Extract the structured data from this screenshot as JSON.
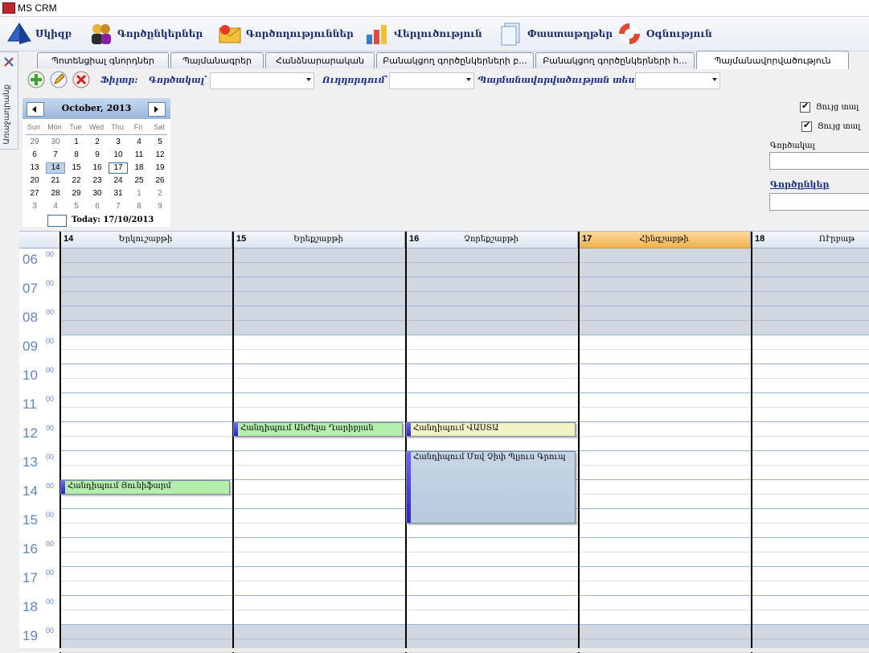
{
  "window": {
    "title": "MS CRM"
  },
  "menu": [
    {
      "label": "Սկիզբ",
      "icon": "pyramid-icon"
    },
    {
      "label": "Գործընկերներ",
      "icon": "people-icon"
    },
    {
      "label": "Գործողություններ",
      "icon": "envelope-icon"
    },
    {
      "label": "Վերլուծություն",
      "icon": "chart-icon"
    },
    {
      "label": "Փաստաթղթեր",
      "icon": "documents-icon"
    },
    {
      "label": "Օգնություն",
      "icon": "lifebuoy-icon"
    }
  ],
  "side_tab": {
    "label": "Առաջադրանք"
  },
  "tabs": [
    {
      "label": "Պոտենցիալ գնորդներ"
    },
    {
      "label": "Պայմանագրեր"
    },
    {
      "label": "Հանձնարարական"
    },
    {
      "label": "Բանակցող գործընկերների բ..."
    },
    {
      "label": "Բանակցող գործընկերների h..."
    },
    {
      "label": "Պայմանավորվածություն",
      "active": true
    }
  ],
  "toolbar": {
    "filter_label": "Ֆիլտր:",
    "employee_label": "Գործակալ՝",
    "direction_label": "Ուղղորդում՝",
    "appointment_type_label": "Պայմանավորվածության տեսակ",
    "employee_value": "",
    "direction_value": "",
    "appointment_type_value": ""
  },
  "calendar": {
    "month_label": "October, 2013",
    "weekdays": [
      "Sun",
      "Mon",
      "Tue",
      "Wed",
      "Thu",
      "Fri",
      "Sat"
    ],
    "weeks": [
      [
        [
          "29",
          1
        ],
        [
          "30",
          1
        ],
        [
          "1",
          0
        ],
        [
          "2",
          0
        ],
        [
          "3",
          0
        ],
        [
          "4",
          0
        ],
        [
          "5",
          0
        ]
      ],
      [
        [
          "6",
          0
        ],
        [
          "7",
          0
        ],
        [
          "8",
          0
        ],
        [
          "9",
          0
        ],
        [
          "10",
          0
        ],
        [
          "11",
          0
        ],
        [
          "12",
          0
        ]
      ],
      [
        [
          "13",
          0
        ],
        [
          "14",
          0
        ],
        [
          "15",
          0
        ],
        [
          "16",
          0
        ],
        [
          "17",
          0
        ],
        [
          "18",
          0
        ],
        [
          "19",
          0
        ]
      ],
      [
        [
          "20",
          0
        ],
        [
          "21",
          0
        ],
        [
          "22",
          0
        ],
        [
          "23",
          0
        ],
        [
          "24",
          0
        ],
        [
          "25",
          0
        ],
        [
          "26",
          0
        ]
      ],
      [
        [
          "27",
          0
        ],
        [
          "28",
          0
        ],
        [
          "29",
          0
        ],
        [
          "30",
          0
        ],
        [
          "31",
          0
        ],
        [
          "1",
          1
        ],
        [
          "2",
          1
        ]
      ],
      [
        [
          "3",
          1
        ],
        [
          "4",
          1
        ],
        [
          "5",
          1
        ],
        [
          "6",
          1
        ],
        [
          "7",
          1
        ],
        [
          "8",
          1
        ],
        [
          "9",
          1
        ]
      ]
    ],
    "selected_day": "14",
    "today_day": "17",
    "today_label": "Today: 17/10/2013"
  },
  "right_panel": {
    "checkbox1_label": "Ցույց տալ",
    "checkbox2_label": "Ցույց տալ",
    "agent_label": "Գործակալ",
    "partners_label": "Գործընկեր"
  },
  "schedule": {
    "days": [
      {
        "num": "14",
        "name": "Երկուշաբթի"
      },
      {
        "num": "15",
        "name": "Երեքշաբթի"
      },
      {
        "num": "16",
        "name": "Չորեքշաբթի"
      },
      {
        "num": "17",
        "name": "Հինգշաբթի",
        "current": true
      },
      {
        "num": "18",
        "name": "ՈՒրբաթ"
      }
    ],
    "hours": [
      "06",
      "07",
      "08",
      "09",
      "10",
      "11",
      "12",
      "13",
      "14",
      "15",
      "16",
      "17",
      "18",
      "19"
    ],
    "minutes_label": "00",
    "appointments": [
      {
        "day": 1,
        "start": 12.0,
        "end": 12.5,
        "text": "Հանդիպում Անժելա Ղարիբյան",
        "color": "#b3eeaa"
      },
      {
        "day": 2,
        "start": 12.0,
        "end": 12.5,
        "text": "Հանդիպում ՎԱՍՏԱ",
        "color": "#f0f3c2"
      },
      {
        "day": 2,
        "start": 13.0,
        "end": 15.5,
        "text": "Հանդիպում Մով Չիփ Պլյուս Գրուպ",
        "color": "#c7d6e6"
      },
      {
        "day": 0,
        "start": 14.0,
        "end": 14.5,
        "text": "Հանդիպում Յունիֆարմ",
        "color": "#b3eeaa"
      }
    ]
  },
  "colors": {
    "accent": "#5f86bf",
    "current_day": "#f0b24b",
    "off_hours": "#d0d7e0"
  }
}
